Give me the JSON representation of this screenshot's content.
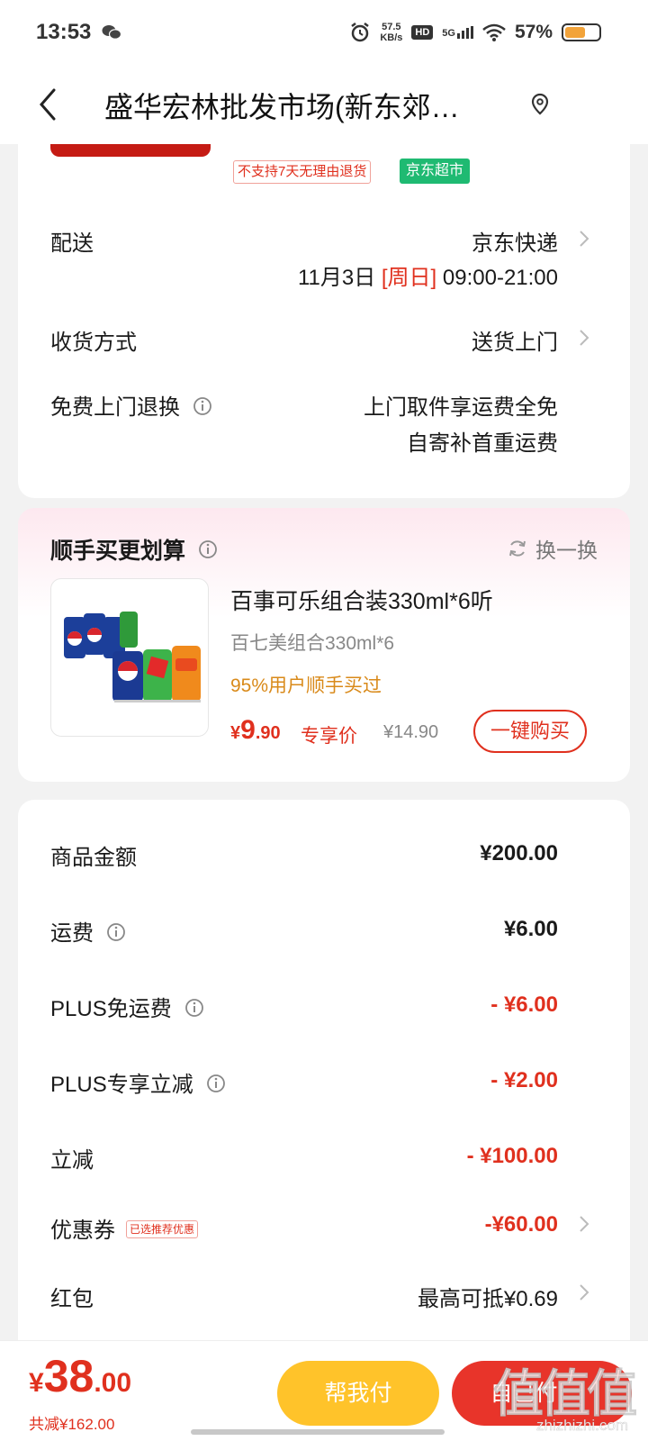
{
  "status_bar": {
    "time": "13:53",
    "net_speed_top": "57.5",
    "net_speed_bottom": "KB/s",
    "hd": "HD",
    "signal": "5G",
    "battery": "57%"
  },
  "nav": {
    "title": "盛华宏林批发市场(新东郊…",
    "back_icon": "chevron-left-icon",
    "location_icon": "location-pin-icon"
  },
  "shipping_card": {
    "tags": {
      "no_return": "不支持7天无理由退货",
      "jd_market": "京东超市"
    },
    "delivery": {
      "label": "配送",
      "value": "京东快递",
      "date": "11月3日",
      "weekday": "[周日]",
      "time": "09:00-21:00"
    },
    "receive": {
      "label": "收货方式",
      "value": "送货上门"
    },
    "free_return": {
      "label": "免费上门退换",
      "line1": "上门取件享运费全免",
      "line2": "自寄补首重运费"
    }
  },
  "recommend_card": {
    "title": "顺手买更划算",
    "refresh_label": "换一换",
    "product": {
      "name": "百事可乐组合装330ml*6听",
      "subtitle": "百七美组合330ml*6",
      "percent_text": "95%用户顺手买过",
      "price_symbol": "¥",
      "price_int": "9",
      "price_dec": ".90",
      "exclusive_label": "专享价",
      "original_price": "¥14.90",
      "buy_label": "一键购买"
    }
  },
  "amounts_card": {
    "goods_total": {
      "label": "商品金额",
      "value": "¥200.00"
    },
    "shipping_fee": {
      "label": "运费",
      "value": "¥6.00"
    },
    "plus_free_shipping": {
      "label": "PLUS免运费",
      "value": "- ¥6.00"
    },
    "plus_discount": {
      "label": "PLUS专享立减",
      "value": "- ¥2.00"
    },
    "instant_discount": {
      "label": "立减",
      "value": "- ¥100.00"
    },
    "coupon": {
      "label": "优惠券",
      "tag": "已选推荐优惠",
      "value": "-¥60.00"
    },
    "red_packet": {
      "label": "红包",
      "value": "最高可抵¥0.69"
    }
  },
  "bottom_bar": {
    "total_symbol": "¥",
    "total_int": "38",
    "total_dec": ".00",
    "saved": "共减¥162.00",
    "help_pay_label": "帮我付",
    "submit_label": "自己付",
    "watermark": "值值值",
    "watermark_url": "zhizhizhi.com"
  },
  "colors": {
    "accent_red": "#e0301e",
    "help_pay_yellow": "#ffc32a",
    "jd_market_green": "#1fba72",
    "percent_orange": "#d98a1a"
  }
}
